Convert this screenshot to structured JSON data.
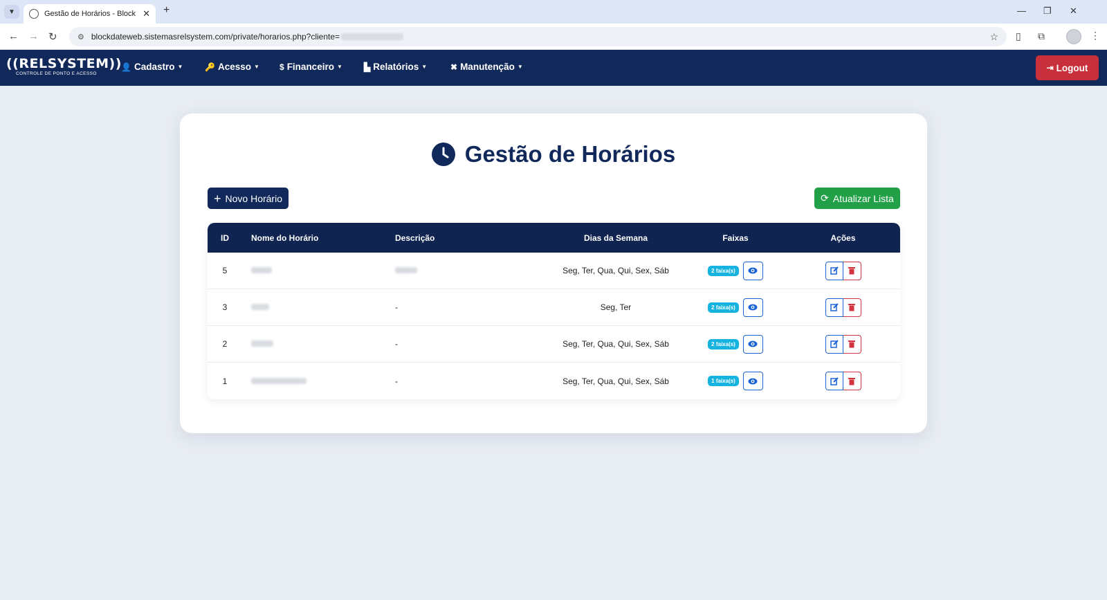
{
  "browser": {
    "tab_title": "Gestão de Horários - Block Dat",
    "url": "blockdateweb.sistemasrelsystem.com/private/horarios.php?cliente="
  },
  "navbar": {
    "logo_text": "((RELSYSTEM))",
    "logo_tagline": "CONTROLE DE PONTO E ACESSO",
    "menu": [
      {
        "label": "Cadastro",
        "icon": "user-plus-icon"
      },
      {
        "label": "Acesso",
        "icon": "key-icon"
      },
      {
        "label": "Financeiro",
        "icon": "dollar-icon"
      },
      {
        "label": "Relatórios",
        "icon": "chart-icon"
      },
      {
        "label": "Manutenção",
        "icon": "tools-icon"
      }
    ],
    "logout_label": "Logout"
  },
  "page": {
    "title": "Gestão de Horários",
    "new_button": "Novo Horário",
    "refresh_button": "Atualizar Lista"
  },
  "table": {
    "headers": [
      "ID",
      "Nome do Horário",
      "Descrição",
      "Dias da Semana",
      "Faixas",
      "Ações"
    ],
    "rows": [
      {
        "id": "5",
        "descricao": "",
        "dias": "Seg, Ter, Qua, Qui, Sex, Sáb",
        "faixas": "2 faixa(s)"
      },
      {
        "id": "3",
        "descricao": "-",
        "dias": "Seg, Ter",
        "faixas": "2 faixa(s)"
      },
      {
        "id": "2",
        "descricao": "-",
        "dias": "Seg, Ter, Qua, Qui, Sex, Sáb",
        "faixas": "2 faixa(s)"
      },
      {
        "id": "1",
        "descricao": "-",
        "dias": "Seg, Ter, Qua, Qui, Sex, Sáb",
        "faixas": "1 faixa(s)"
      }
    ]
  },
  "colors": {
    "navy": "#11295a",
    "success": "#22a047",
    "danger": "#c8303b",
    "info": "#16b3e0",
    "primary": "#1c63d6"
  }
}
